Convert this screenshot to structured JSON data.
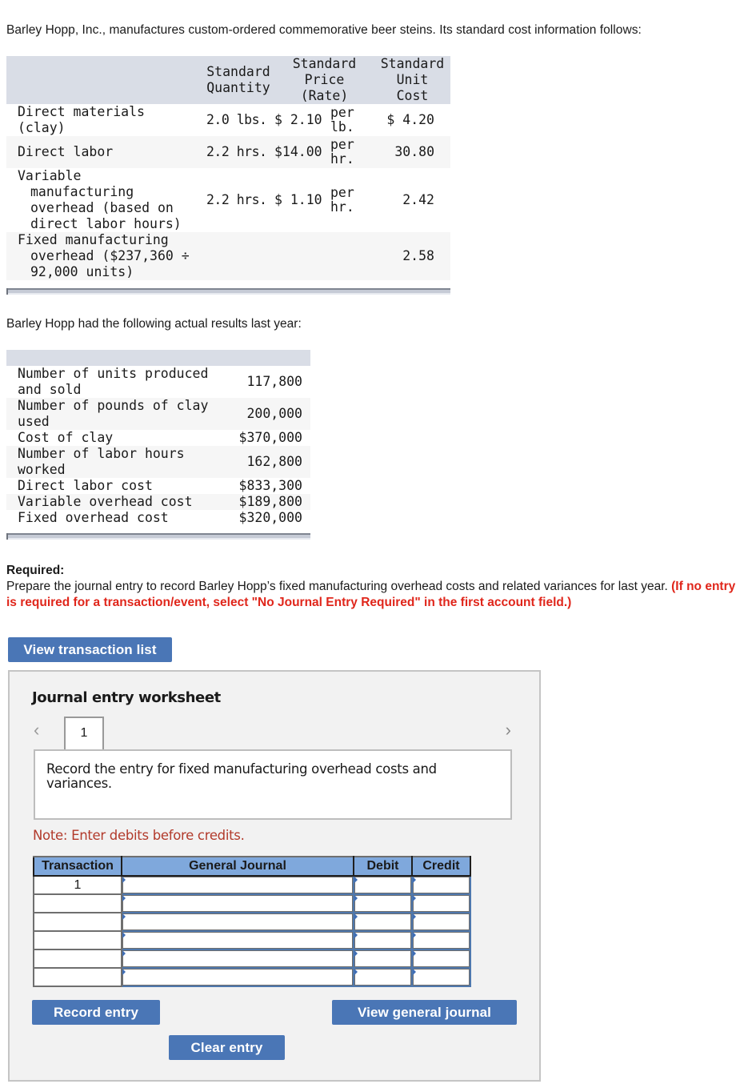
{
  "intro_text": "Barley Hopp, Inc., manufactures custom-ordered commemorative beer steins. Its standard cost information follows:",
  "standard_table": {
    "headers": {
      "quantity": [
        "Standard",
        "Quantity"
      ],
      "price": [
        "Standard",
        "Price",
        "(Rate)"
      ],
      "unit_cost": [
        "Standard",
        "Unit",
        "Cost"
      ]
    },
    "rows": [
      {
        "label": [
          "Direct materials",
          "(clay)"
        ],
        "quantity": "2.0 lbs.",
        "price": "$ 2.10",
        "per": [
          "per",
          "lb."
        ],
        "unit_cost": "$ 4.20"
      },
      {
        "label": [
          "Direct labor"
        ],
        "quantity": "2.2 hrs.",
        "price": "$14.00",
        "per": [
          "per",
          "hr."
        ],
        "unit_cost": "30.80"
      },
      {
        "label": [
          "Variable",
          "manufacturing",
          "overhead (based on",
          "direct labor hours)"
        ],
        "quantity": "2.2 hrs.",
        "price": "$ 1.10",
        "per": [
          "per",
          "hr."
        ],
        "unit_cost": "2.42"
      },
      {
        "label": [
          "Fixed manufacturing",
          "overhead ($237,360 ÷",
          "92,000 units)"
        ],
        "quantity": "",
        "price": "",
        "per": [
          "",
          ""
        ],
        "unit_cost": "2.58"
      }
    ]
  },
  "actual_intro": "Barley Hopp had the following actual results last year:",
  "actual_table": {
    "rows": [
      {
        "label": [
          "Number of units produced",
          "and sold"
        ],
        "value": "117,800"
      },
      {
        "label": [
          "Number of pounds of clay",
          "used"
        ],
        "value": "200,000"
      },
      {
        "label": [
          "Cost of clay"
        ],
        "value": "$370,000"
      },
      {
        "label": [
          "Number of labor hours",
          "worked"
        ],
        "value": "162,800"
      },
      {
        "label": [
          "Direct labor cost"
        ],
        "value": "$833,300"
      },
      {
        "label": [
          "Variable overhead cost"
        ],
        "value": "$189,800"
      },
      {
        "label": [
          "Fixed overhead cost"
        ],
        "value": "$320,000"
      }
    ]
  },
  "required": {
    "title": "Required:",
    "text": "Prepare the journal entry to record Barley Hopp’s fixed manufacturing overhead costs and related variances for last year.",
    "instruction": "(If no entry is required for a transaction/event, select \"No Journal Entry Required\" in the first account field.)"
  },
  "buttons": {
    "view_transaction_list": "View transaction list",
    "record_entry": "Record entry",
    "view_general_journal": "View general journal",
    "clear_entry": "Clear entry"
  },
  "worksheet": {
    "title": "Journal entry worksheet",
    "active_tab": "1",
    "nav_prev_icon": "chevron-left-icon",
    "nav_next_icon": "chevron-right-icon",
    "prompt": "Record the entry for fixed manufacturing overhead costs and variances.",
    "note": "Note: Enter debits before credits.",
    "journal": {
      "headers": {
        "transaction": "Transaction",
        "general_journal": "General Journal",
        "debit": "Debit",
        "credit": "Credit"
      },
      "rows": [
        {
          "transaction": "1",
          "account": "",
          "debit": "",
          "credit": ""
        },
        {
          "transaction": "",
          "account": "",
          "debit": "",
          "credit": ""
        },
        {
          "transaction": "",
          "account": "",
          "debit": "",
          "credit": ""
        },
        {
          "transaction": "",
          "account": "",
          "debit": "",
          "credit": ""
        },
        {
          "transaction": "",
          "account": "",
          "debit": "",
          "credit": ""
        },
        {
          "transaction": "",
          "account": "",
          "debit": "",
          "credit": ""
        }
      ]
    }
  },
  "colors": {
    "button_blue": "#4a76b6",
    "table_header_band": "#d9dde6",
    "journal_header": "#7fa8dc",
    "instruction_red": "#e0261b",
    "note_red": "#b23a2b"
  }
}
